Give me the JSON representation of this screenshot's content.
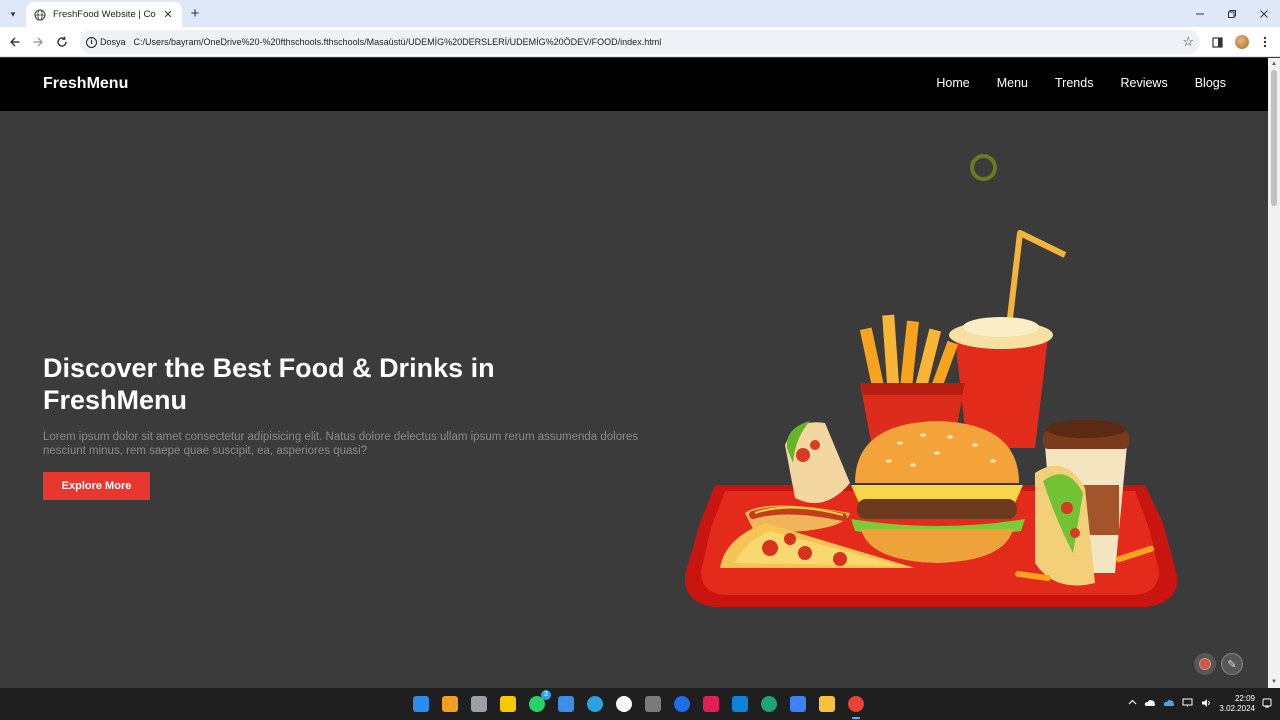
{
  "browser": {
    "tab_title": "FreshFood Website | Code Me...",
    "address_site_label": "Dosya",
    "url": "C:/Users/bayram/OneDrive%20-%20fthschools.fthschools/Masaüstü/UDEMİG%20DERSLERİ/UDEMİG%20ÖDEV/FOOD/index.html",
    "new_tab_glyph": "+",
    "close_glyph": "✕",
    "info_glyph": "i",
    "star_glyph": "☆"
  },
  "site": {
    "logo": "FreshMenu",
    "nav": [
      {
        "label": "Home"
      },
      {
        "label": "Menu"
      },
      {
        "label": "Trends"
      },
      {
        "label": "Reviews"
      },
      {
        "label": "Blogs"
      }
    ],
    "hero": {
      "title": "Discover the Best Food & Drinks in FreshMenu",
      "text": "Lorem ipsum dolor sit amet consectetur adipisicing elit. Natus dolore delectus ullam ipsum rerum assumenda dolores nesciunt minus, rem saepe quae suscipit, ea, asperiores quasi?",
      "cta": "Explore More"
    }
  },
  "taskbar": {
    "apps": [
      {
        "icon": "windows-start-icon",
        "color": "#2b8cf0"
      },
      {
        "icon": "weather-icon",
        "color": "#f0a020"
      },
      {
        "icon": "task-view-icon",
        "color": "#9aa0a8"
      },
      {
        "icon": "sticky-notes-icon",
        "color": "#f5c800"
      },
      {
        "icon": "whatsapp-icon",
        "color": "#25d366"
      },
      {
        "icon": "file-editor-icon",
        "color": "#3a8ee6"
      },
      {
        "icon": "telegram-icon",
        "color": "#2aa3e0"
      },
      {
        "icon": "github-icon",
        "color": "#ffffff"
      },
      {
        "icon": "git-icon",
        "color": "#7a7a7a"
      },
      {
        "icon": "chat-icon",
        "color": "#1f6feb"
      },
      {
        "icon": "slack-icon",
        "color": "#e01e5a"
      },
      {
        "icon": "vscode-icon",
        "color": "#0a84d6"
      },
      {
        "icon": "edge-icon",
        "color": "#1fa37a"
      },
      {
        "icon": "store-icon",
        "color": "#3c82f6"
      },
      {
        "icon": "file-explorer-icon",
        "color": "#f2c23a"
      },
      {
        "icon": "chrome-icon",
        "color": "#ea4335"
      }
    ],
    "whatsapp_badge": "3",
    "time": "22:09",
    "date": "3.02.2024"
  }
}
